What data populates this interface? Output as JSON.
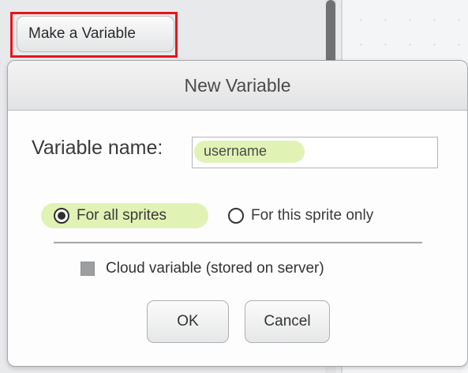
{
  "palette": {
    "make_variable_label": "Make a Variable"
  },
  "dialog": {
    "title": "New Variable",
    "name_label": "Variable name:",
    "name_value": "username",
    "scope_options": [
      {
        "label": "For all sprites",
        "selected": true
      },
      {
        "label": "For this sprite only",
        "selected": false
      }
    ],
    "cloud_label": "Cloud variable (stored on server)",
    "cloud_checked": false,
    "ok_label": "OK",
    "cancel_label": "Cancel"
  },
  "colors": {
    "highlight_red": "#e8141b",
    "highlight_green": "#e1f3b4"
  }
}
